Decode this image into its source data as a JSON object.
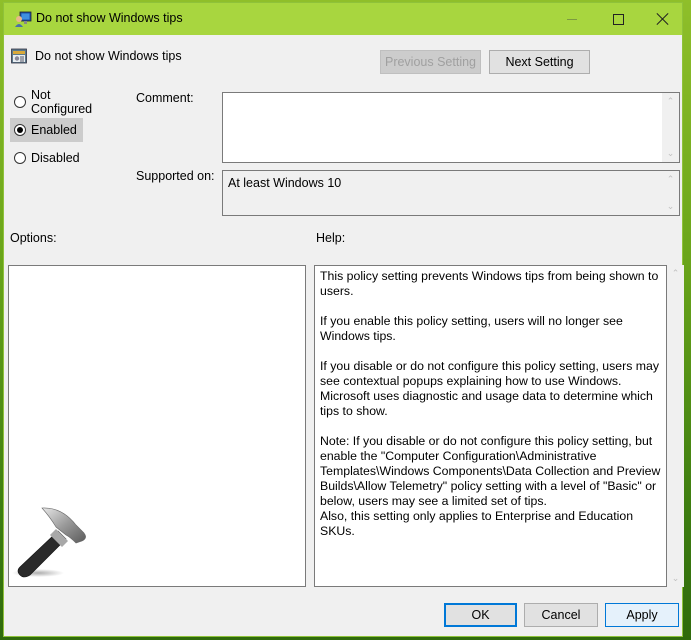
{
  "window": {
    "title": "Do not show Windows tips",
    "controls": {
      "minimize": "minimize-icon",
      "maximize": "maximize-icon",
      "close": "close-icon"
    }
  },
  "header": {
    "policy_name": "Do not show Windows tips",
    "previous_setting_label": "Previous Setting",
    "next_setting_label": "Next Setting"
  },
  "state": {
    "options": [
      {
        "label": "Not Configured",
        "selected": false
      },
      {
        "label": "Enabled",
        "selected": true
      },
      {
        "label": "Disabled",
        "selected": false
      }
    ]
  },
  "comment": {
    "label": "Comment:",
    "value": ""
  },
  "supported": {
    "label": "Supported on:",
    "value": "At least Windows 10"
  },
  "options_section": {
    "label": "Options:"
  },
  "help_section": {
    "label": "Help:",
    "text": "This policy setting prevents Windows tips from being shown to users.\n\nIf you enable this policy setting, users will no longer see Windows tips.\n\nIf you disable or do not configure this policy setting, users may see contextual popups explaining how to use Windows. Microsoft uses diagnostic and usage data to determine which tips to show.\n\nNote: If you disable or do not configure this policy setting, but enable the \"Computer Configuration\\Administrative Templates\\Windows Components\\Data Collection and Preview Builds\\Allow Telemetry\" policy setting with a level of \"Basic\" or below, users may see a limited set of tips.\nAlso, this setting only applies to Enterprise and Education SKUs."
  },
  "footer": {
    "ok_label": "OK",
    "cancel_label": "Cancel",
    "apply_label": "Apply"
  },
  "colors": {
    "titlebar": "#a8d63f",
    "dialog_bg": "#f0f0f0",
    "focus_blue": "#0078d7"
  }
}
